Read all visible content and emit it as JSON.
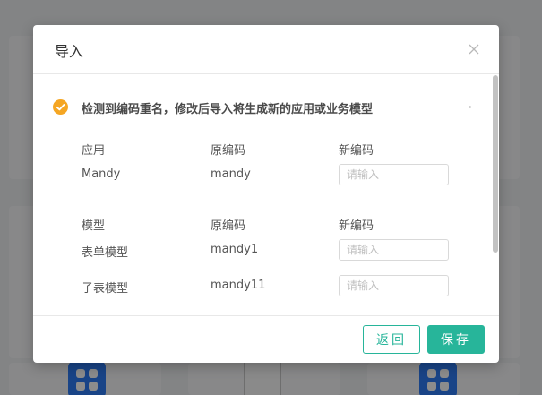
{
  "dialog": {
    "title": "导入",
    "close_icon": "close-icon",
    "notice": {
      "icon": "check-circle-icon",
      "text": "检测到编码重名，修改后导入将生成新的应用或业务模型",
      "icon_color": "#f5a623"
    },
    "sections": [
      {
        "headers": [
          "应用",
          "原编码",
          "新编码"
        ],
        "rows": [
          {
            "name": "Mandy",
            "original_code": "mandy",
            "new_code": "",
            "placeholder": "请输入"
          }
        ]
      },
      {
        "headers": [
          "模型",
          "原编码",
          "新编码"
        ],
        "rows": [
          {
            "name": "表单模型",
            "original_code": "mandy1",
            "new_code": "",
            "placeholder": "请输入"
          },
          {
            "name": "子表模型",
            "original_code": "mandy11",
            "new_code": "",
            "placeholder": "请输入"
          }
        ]
      }
    ],
    "footer": {
      "back_label": "返回",
      "save_label": "保存"
    }
  },
  "background": {
    "app_icon": "grid-apps-icon",
    "image_placeholder": "broken-image-icon"
  },
  "colors": {
    "accent": "#27b59a",
    "notice_icon": "#f5a623",
    "overlay": "rgba(0,0,0,0.45)"
  }
}
